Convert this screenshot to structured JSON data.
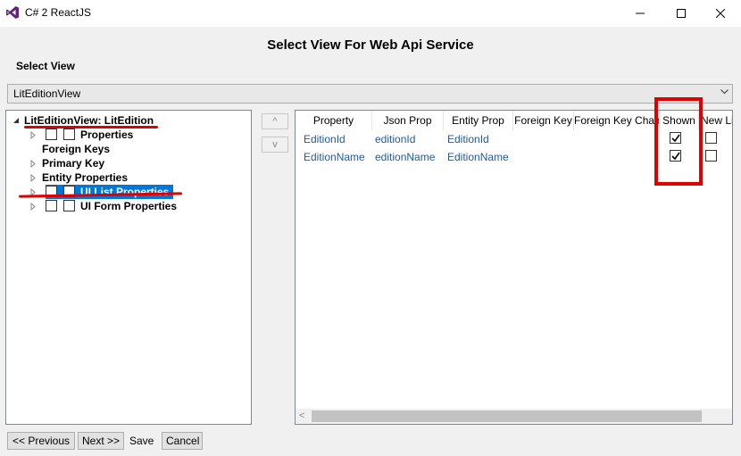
{
  "window": {
    "title": "C# 2 ReactJS",
    "controls": [
      "minimize-icon",
      "maximize-icon",
      "close-icon"
    ]
  },
  "dialog": {
    "title": "Select View For Web Api Service",
    "select_view_label": "Select View"
  },
  "view_selector": {
    "value": "LitEditionView"
  },
  "tree": {
    "root": "LitEditionView: LitEdition",
    "nodes": [
      {
        "label": "Properties",
        "expandable": true,
        "checkboxes": 2,
        "selected": false
      },
      {
        "label": "Foreign Keys",
        "expandable": false,
        "checkboxes": 0,
        "selected": false
      },
      {
        "label": "Primary Key",
        "expandable": true,
        "checkboxes": 0,
        "selected": false
      },
      {
        "label": "Entity Properties",
        "expandable": true,
        "checkboxes": 0,
        "selected": false
      },
      {
        "label": "UI List Properties",
        "expandable": true,
        "checkboxes": 2,
        "selected": true
      },
      {
        "label": "UI Form Properties",
        "expandable": true,
        "checkboxes": 2,
        "selected": false
      }
    ]
  },
  "move_buttons": {
    "up": "^",
    "down": "v"
  },
  "grid": {
    "columns": [
      "Property",
      "Json Prop",
      "Entity Prop",
      "Foreign Key",
      "Foreign Key Chain",
      "Shown",
      "New Li"
    ],
    "rows": [
      {
        "property": "EditionId",
        "json_prop": "editionId",
        "entity_prop": "EditionId",
        "foreign_key": "",
        "foreign_key_chain": "",
        "shown": true,
        "new_line": false
      },
      {
        "property": "EditionName",
        "json_prop": "editionName",
        "entity_prop": "EditionName",
        "foreign_key": "",
        "foreign_key_chain": "",
        "shown": true,
        "new_line": false
      }
    ],
    "scroll_left_arrow": "<"
  },
  "footer": {
    "previous": "<< Previous",
    "next": "Next >>",
    "save": "Save",
    "cancel": "Cancel"
  },
  "colors": {
    "selection": "#0078d7",
    "annotation_red": "#e00000",
    "cell_text": "#1e5aa8",
    "vs_purple": "#68217a"
  }
}
